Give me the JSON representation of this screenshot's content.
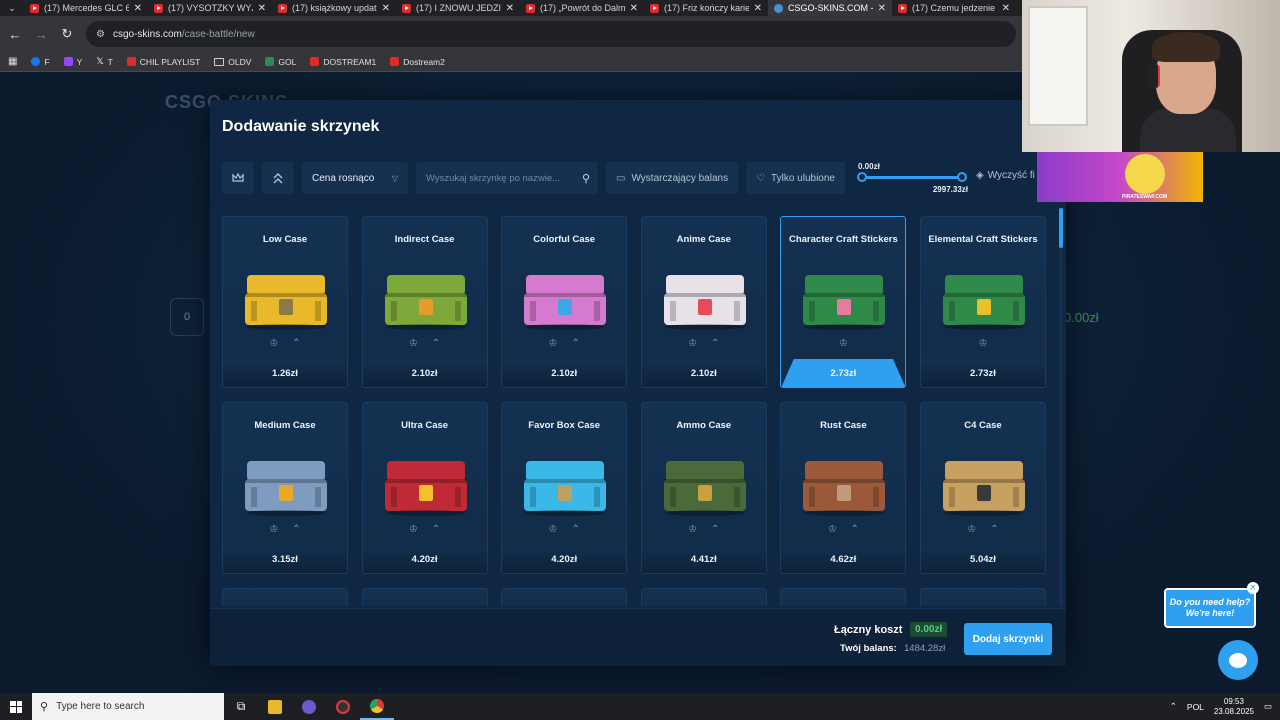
{
  "browser": {
    "tabs": [
      {
        "title": "(17) Mercedes GLC 6"
      },
      {
        "title": "(17) VYSOTZKY WYJA"
      },
      {
        "title": "(17) książkowy updat"
      },
      {
        "title": "(17) I ZNOWU JEDZIE"
      },
      {
        "title": "(17) „Powrót do Dalm"
      },
      {
        "title": "(17) Friz kończy karie"
      },
      {
        "title": "CSGO-SKINS.COM -"
      },
      {
        "title": "(17) Czemu jedzenie"
      }
    ],
    "url_domain": "csgo-skins.com",
    "url_path": "/case-battle/new",
    "bookmarks": [
      "F",
      "Y",
      "T",
      "CHIL PLAYLIST",
      "OLDV",
      "GOL",
      "DOSTREAM1",
      "Dostream2"
    ]
  },
  "background": {
    "logo": "CSGO SKINS",
    "counter": "0",
    "price": "0.00zł"
  },
  "modal": {
    "title": "Dodawanie skrzynek",
    "sort_label": "Cena rosnąco",
    "search_placeholder": "Wyszukaj skrzynkę po nazwie...",
    "balance_filter_label": "Wystarczający balans",
    "favorites_filter_label": "Tylko ulubione",
    "range_min": "0.00zł",
    "range_max": "2997.33zł",
    "range_fraction_min": 0,
    "range_fraction_max": 1,
    "clear_label": "Wyczyść fi",
    "cases": [
      {
        "name": "Low Case",
        "price": "1.26zł",
        "color": "#e8b92a",
        "accent": "#8a7a4a"
      },
      {
        "name": "Indirect Case",
        "price": "2.10zł",
        "color": "#7da83a",
        "accent": "#e89a2a"
      },
      {
        "name": "Colorful Case",
        "price": "2.10zł",
        "color": "#d67ad0",
        "accent": "#3aa7e8"
      },
      {
        "name": "Anime Case",
        "price": "2.10zł",
        "color": "#e8e2e8",
        "accent": "#e84a5a"
      },
      {
        "name": "Character Craft Stickers",
        "price": "2.73zł",
        "color": "#2f8a4a",
        "accent": "#e87aa0",
        "selected": true
      },
      {
        "name": "Elemental Craft Stickers",
        "price": "2.73zł",
        "color": "#2f8a4a",
        "accent": "#e8c02a"
      },
      {
        "name": "Medium Case",
        "price": "3.15zł",
        "color": "#7d9cc0",
        "accent": "#e8a82a"
      },
      {
        "name": "Ultra Case",
        "price": "4.20zł",
        "color": "#c02a36",
        "accent": "#f5c02a"
      },
      {
        "name": "Favor Box Case",
        "price": "4.20zł",
        "color": "#3ab8e8",
        "accent": "#c0a060"
      },
      {
        "name": "Ammo Case",
        "price": "4.41zł",
        "color": "#4a6a3a",
        "accent": "#c8a040"
      },
      {
        "name": "Rust Case",
        "price": "4.62zł",
        "color": "#9a5a3a",
        "accent": "#c09a7a"
      },
      {
        "name": "C4 Case",
        "price": "5.04zł",
        "color": "#c8a060",
        "accent": "#3a3a3a"
      }
    ],
    "partial_row": [
      "",
      "",
      "",
      "",
      "",
      ""
    ],
    "total_label": "Łączny koszt",
    "total_value": "0.00zł",
    "balance_label": "Twój balans:",
    "balance_value": "1484.28zł",
    "add_button": "Dodaj skrzynki"
  },
  "help": {
    "line1": "Do you need help?",
    "line2": "We're here!"
  },
  "stream_banner": "PIRATESWAP.COM",
  "taskbar": {
    "search_placeholder": "Type here to search",
    "lang": "POL",
    "time": "09:53",
    "date": "23.08.2025"
  },
  "colors": {
    "accent": "#2fa0ef",
    "success": "#49d37a",
    "modal_bg": "#0f2742"
  }
}
